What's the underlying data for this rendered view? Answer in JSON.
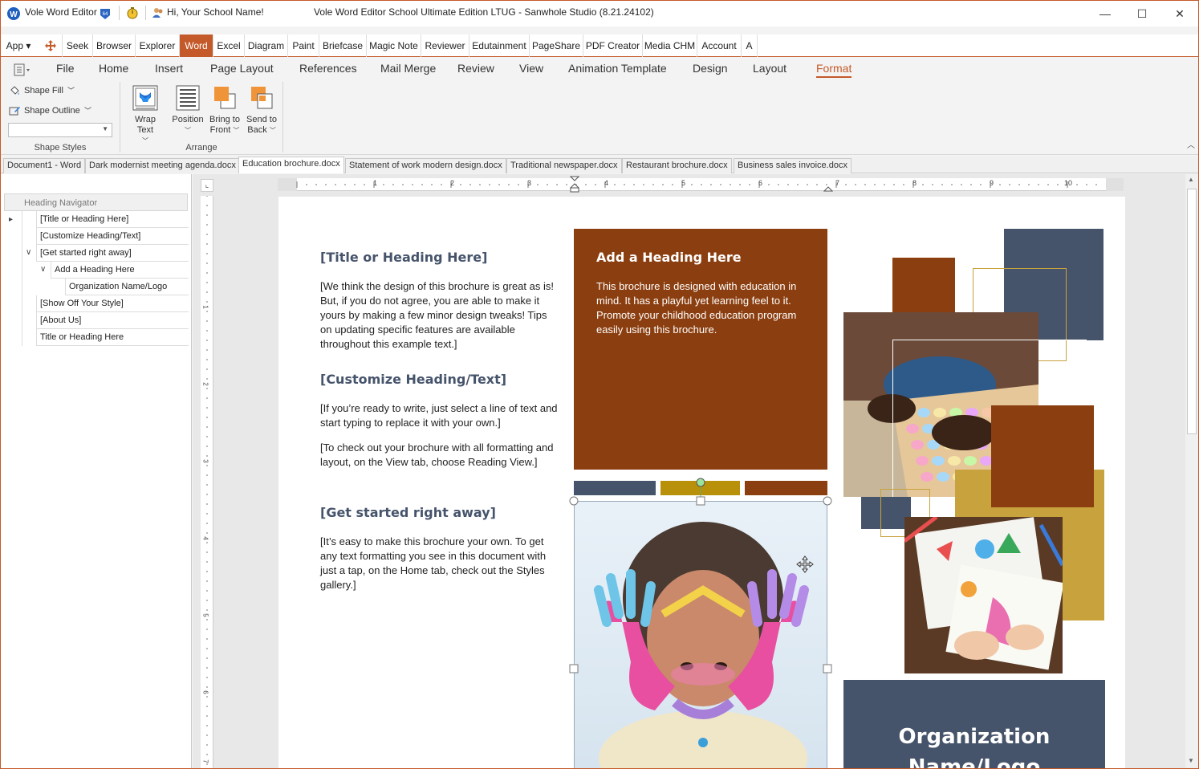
{
  "titlebar": {
    "app_name": "Vole Word Editor",
    "greeting": "Hi, Your School Name!",
    "window_title": "Vole Word Editor School Ultimate Edition LTUG - Sanwhole Studio (8.21.24102)",
    "minimize": "—",
    "maximize": "☐",
    "close": "✕"
  },
  "appmenu": {
    "app_label": "App",
    "items": [
      "Seek",
      "Browser",
      "Explorer",
      "Word",
      "Excel",
      "Diagram",
      "Paint",
      "Briefcase",
      "Magic Note",
      "Reviewer",
      "Edutainment",
      "PageShare",
      "PDF Creator",
      "Media CHM",
      "Account",
      "A"
    ],
    "active": "Word"
  },
  "ribbon_tabs": {
    "items": [
      "File",
      "Home",
      "Insert",
      "Page Layout",
      "References",
      "Mail Merge",
      "Review",
      "View",
      "Animation Template",
      "Design",
      "Layout",
      "Format"
    ],
    "active": "Format"
  },
  "ribbon": {
    "shape_fill": "Shape Fill",
    "shape_outline": "Shape Outline",
    "shape_styles_label": "Shape Styles",
    "arrange_label": "Arrange",
    "wrap_text": "Wrap Text",
    "position": "Position",
    "bring_to_front_1": "Bring to",
    "bring_to_front_2": "Front",
    "send_to_back_1": "Send to",
    "send_to_back_2": "Back"
  },
  "doc_tabs": {
    "items": [
      "Document1 - Word",
      "Dark modernist meeting agenda.docx",
      "Education brochure.docx",
      "Statement of work modern design.docx",
      "Traditional newspaper.docx",
      "Restaurant brochure.docx",
      "Business sales invoice.docx"
    ],
    "active": "Education brochure.docx"
  },
  "navigator": {
    "title": "Heading Navigator",
    "items": [
      "[Title or Heading Here]",
      "[Customize Heading/Text]",
      "[Get started right away]",
      "Add a Heading Here",
      "Organization Name/Logo",
      "[Show Off Your Style]",
      "[About Us]",
      "Title or Heading Here"
    ]
  },
  "ruler": {
    "h_numbers": [
      "1",
      "2",
      "3",
      "4",
      "5",
      "6",
      "7",
      "8",
      "9",
      "10"
    ],
    "v_numbers": [
      "1",
      "2",
      "3",
      "4",
      "5",
      "6",
      "7"
    ]
  },
  "document": {
    "heading1": "[Title or Heading Here]",
    "para1": "[We think the design of this brochure is great as is!  But, if you do not agree, you are able to make it yours by making a few minor design tweaks!  Tips on updating specific features are available throughout this example text.]",
    "heading2": "[Customize Heading/Text]",
    "para2": "[If you’re ready to write, just select a line of text and start typing to replace it with your own.]",
    "para3": "[To check out your brochure with all formatting and layout, on the View tab, choose Reading View.]",
    "heading3": "[Get started right away]",
    "para4": "[It’s easy to make this brochure your own. To get any text formatting you see in this document with just a tap, on the Home tab, check out the Styles gallery.]",
    "box_heading": "Add a Heading Here",
    "box_text": "This brochure is designed with education in mind.  It has a playful yet learning feel to it. Promote your childhood education program easily using this brochure.",
    "org_line1": "Organization",
    "org_line2": "Name/Logo"
  },
  "colors": {
    "accent": "#c45a2a",
    "brown": "#8b3e0f",
    "slate": "#46546b",
    "gold": "#c8a23c",
    "mustard": "#b8900a"
  }
}
